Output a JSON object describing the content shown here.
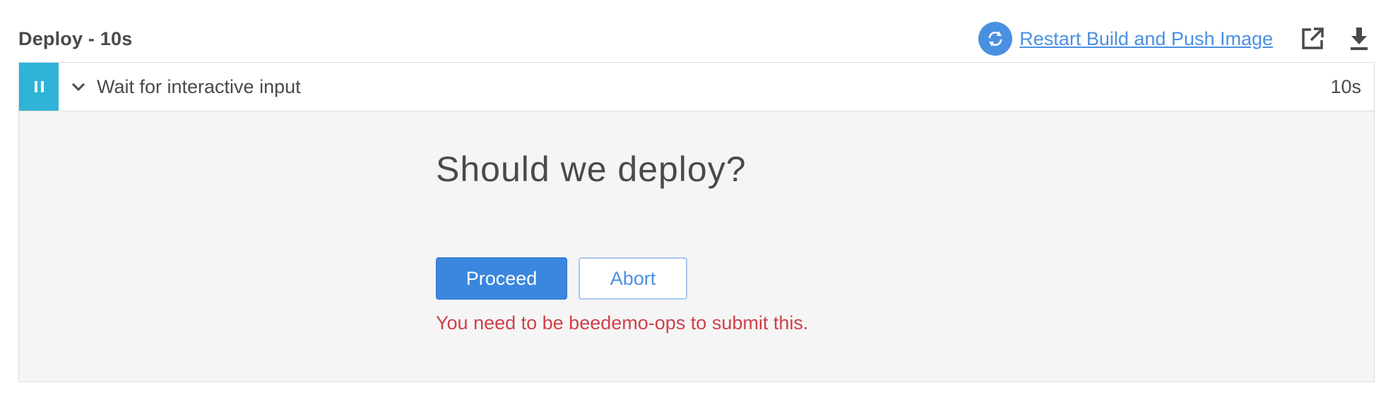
{
  "header": {
    "title": "Deploy - 10s",
    "restart_label": "Restart Build and Push Image",
    "icons": {
      "restart": "refresh-icon",
      "open": "external-link-icon",
      "download": "download-icon"
    }
  },
  "step": {
    "status_icon": "pause-icon",
    "expand_icon": "chevron-down-icon",
    "label": "Wait for interactive input",
    "duration": "10s"
  },
  "input_prompt": {
    "question": "Should we deploy?",
    "proceed_label": "Proceed",
    "abort_label": "Abort",
    "error": "You need to be beedemo-ops to submit this."
  },
  "colors": {
    "accent": "#4a90e2",
    "status_paused": "#2fb3d6",
    "error": "#d0404a",
    "panel_bg": "#f5f5f5"
  }
}
